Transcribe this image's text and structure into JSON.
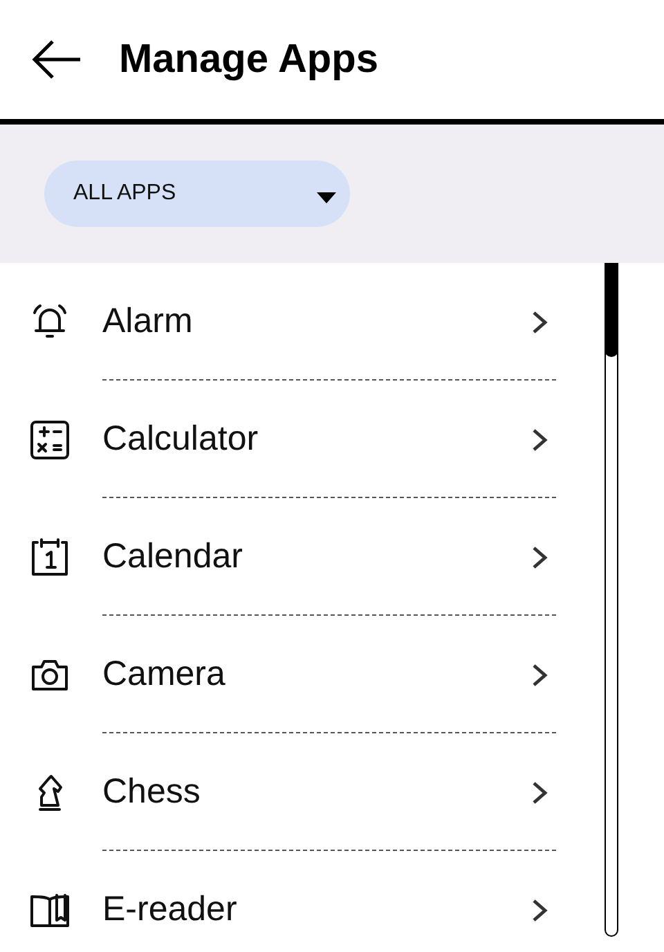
{
  "header": {
    "title": "Manage Apps"
  },
  "filter": {
    "value": "ALL APPS"
  },
  "apps": [
    {
      "name": "Alarm"
    },
    {
      "name": "Calculator"
    },
    {
      "name": "Calendar"
    },
    {
      "name": "Camera"
    },
    {
      "name": "Chess"
    },
    {
      "name": "E-reader"
    }
  ]
}
